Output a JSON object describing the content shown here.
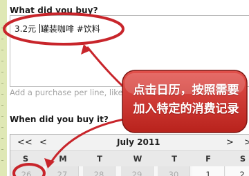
{
  "form": {
    "question_buy": "What did you buy?",
    "entry_prefix": "3.2元 ",
    "entry_suffix": "罐装咖啡 #饮料",
    "hint": "Add a purchase per line, like",
    "question_when": "When did you buy it?"
  },
  "calendar": {
    "prev2_label": "<<",
    "prev_label": "<",
    "month_label": "July 2011",
    "next_label": ">",
    "next2_label": ">",
    "weekdays": [
      "S",
      "M",
      "T",
      "W",
      "T",
      "F",
      "S"
    ],
    "days": [
      "26",
      "27",
      "28",
      "29",
      "30",
      "1",
      "2"
    ]
  },
  "annotation": {
    "line1": "点击日历，按照需要",
    "line2": "加入特定的消费记录",
    "accent_color": "#c8252b"
  }
}
